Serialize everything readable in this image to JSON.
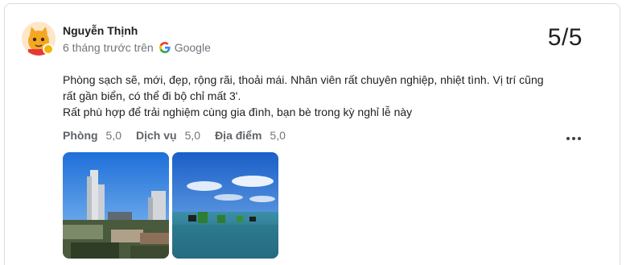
{
  "review": {
    "author": {
      "name": "Nguyễn Thịnh",
      "avatar_icon": "cartoon-cat-avatar"
    },
    "time_ago": "6 tháng trước trên",
    "source": {
      "name": "Google",
      "icon": "google-g-icon"
    },
    "score": "5/5",
    "text_lines": [
      "Phòng sạch sẽ, mới, đẹp, rộng rãi, thoải mái. Nhân viên rất chuyên nghiệp, nhiệt tình. Vị trí cũng",
      "rất gần biển, có thể đi bộ chỉ mất 3'.",
      "Rất phù hợp để trải nghiệm cùng gia đình, bạn bè trong kỳ nghỉ lễ này"
    ],
    "ratings": [
      {
        "label": "Phòng",
        "value": "5,0"
      },
      {
        "label": "Dịch vụ",
        "value": "5,0"
      },
      {
        "label": "Địa điểm",
        "value": "5,0"
      }
    ],
    "more_icon": "more-horizontal-icon",
    "photos": [
      {
        "subject": "city-skyline-with-high-rise-buildings"
      },
      {
        "subject": "people-swimming-in-sea"
      }
    ]
  },
  "colors": {
    "text_primary": "#202124",
    "text_secondary": "#70757a",
    "border": "#dadce0"
  }
}
